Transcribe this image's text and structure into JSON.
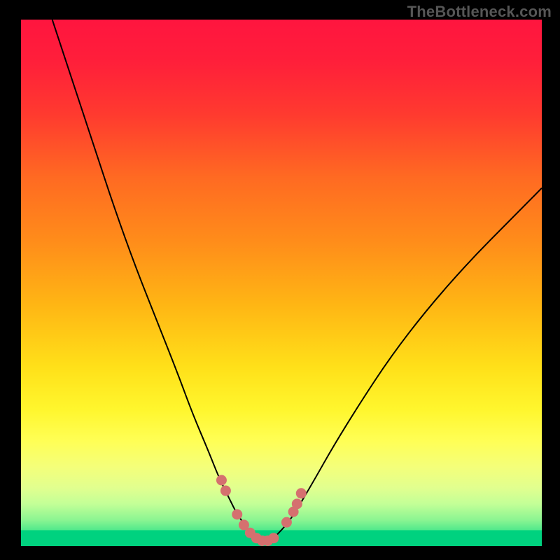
{
  "watermark": "TheBottleneck.com",
  "chart_data": {
    "type": "line",
    "title": "",
    "xlabel": "",
    "ylabel": "",
    "xlim": [
      0,
      100
    ],
    "ylim": [
      0,
      100
    ],
    "series": [
      {
        "name": "left-curve",
        "x": [
          6,
          10,
          14,
          18,
          22,
          26,
          30,
          33,
          36,
          38,
          40,
          41.5,
          43,
          44.5,
          46
        ],
        "y": [
          100,
          88,
          76,
          64,
          53,
          43,
          33,
          25,
          18,
          13,
          9,
          6,
          4,
          2,
          1
        ]
      },
      {
        "name": "right-curve",
        "x": [
          49,
          51,
          53,
          56,
          60,
          65,
          71,
          78,
          86,
          94,
          100
        ],
        "y": [
          2,
          4,
          7,
          12,
          19,
          27,
          36,
          45,
          54,
          62,
          68
        ]
      }
    ],
    "markers": {
      "name": "highlight-dots",
      "color": "#d5706f",
      "points": [
        {
          "x": 38.5,
          "y": 12.5
        },
        {
          "x": 39.3,
          "y": 10.5
        },
        {
          "x": 41.5,
          "y": 6
        },
        {
          "x": 42.8,
          "y": 4
        },
        {
          "x": 44.0,
          "y": 2.5
        },
        {
          "x": 45.2,
          "y": 1.5
        },
        {
          "x": 46.3,
          "y": 1
        },
        {
          "x": 47.4,
          "y": 1
        },
        {
          "x": 48.5,
          "y": 1.5
        },
        {
          "x": 51.0,
          "y": 4.5
        },
        {
          "x": 52.3,
          "y": 6.5
        },
        {
          "x": 53.0,
          "y": 8
        },
        {
          "x": 53.8,
          "y": 10
        }
      ]
    },
    "gradient_stops": [
      {
        "offset": 0,
        "color": "#ff153f"
      },
      {
        "offset": 0.08,
        "color": "#ff1f3a"
      },
      {
        "offset": 0.18,
        "color": "#ff3a2f"
      },
      {
        "offset": 0.3,
        "color": "#ff6a22"
      },
      {
        "offset": 0.42,
        "color": "#ff8c1a"
      },
      {
        "offset": 0.54,
        "color": "#ffb514"
      },
      {
        "offset": 0.66,
        "color": "#ffe019"
      },
      {
        "offset": 0.74,
        "color": "#fff62d"
      },
      {
        "offset": 0.8,
        "color": "#ffff55"
      },
      {
        "offset": 0.85,
        "color": "#f4ff7a"
      },
      {
        "offset": 0.89,
        "color": "#e1ff8f"
      },
      {
        "offset": 0.92,
        "color": "#c3ff97"
      },
      {
        "offset": 0.95,
        "color": "#8cf592"
      },
      {
        "offset": 0.975,
        "color": "#42e68a"
      },
      {
        "offset": 1.0,
        "color": "#00d27f"
      }
    ],
    "green_band": {
      "y0": 0,
      "y1": 3,
      "color": "#00d27f"
    }
  }
}
